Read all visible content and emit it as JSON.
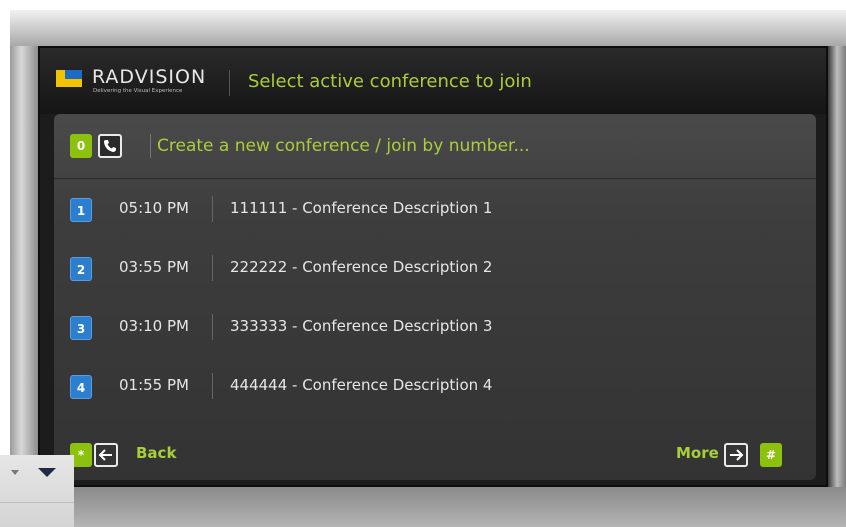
{
  "brand": {
    "name": "RADVISION",
    "tagline": "Delivering the Visual Experience"
  },
  "header": {
    "title": "Select active conference to join"
  },
  "new_conference": {
    "key": "0",
    "icon": "phone-icon",
    "label": "Create a new conference / join by number..."
  },
  "conferences": [
    {
      "key": "1",
      "time": "05:10 PM",
      "description": "111111 - Conference Description 1"
    },
    {
      "key": "2",
      "time": "03:55 PM",
      "description": "222222 - Conference Description 2"
    },
    {
      "key": "3",
      "time": "03:10 PM",
      "description": "333333 - Conference Description 3"
    },
    {
      "key": "4",
      "time": "01:55 PM",
      "description": "444444 - Conference Description 4"
    }
  ],
  "footer": {
    "back_key": "*",
    "back_label": "Back",
    "more_label": "More",
    "more_key": "#"
  },
  "colors": {
    "accent_green": "#8cc20e",
    "text_green": "#a8cf3a",
    "key_blue": "#2c7fce",
    "logo_yellow": "#f2c300",
    "logo_blue": "#1d6bc4"
  }
}
